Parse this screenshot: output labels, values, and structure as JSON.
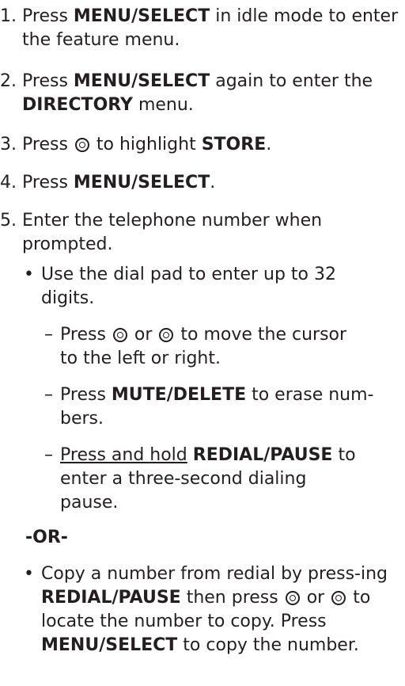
{
  "steps": [
    {
      "num": "1.",
      "a": "Press ",
      "b": "MENU/",
      "c": "SELECT",
      "d": " in idle mode to enter the feature menu."
    },
    {
      "num": "2.",
      "a": "Press ",
      "b": "MENU/",
      "c": "SELECT",
      "d": " again to enter the ",
      "e": "DIRECTORY",
      "f": " menu."
    },
    {
      "num": "3.",
      "a": "Press ",
      "b": " to highlight ",
      "c": "STORE",
      "d": "."
    },
    {
      "num": "4.",
      "a": "Press ",
      "b": "MENU/",
      "c": "SELECT",
      "d": "."
    },
    {
      "num": "5.",
      "a": "Enter the telephone number when prompted."
    }
  ],
  "bullet1": {
    "sym": "•",
    "text": "Use the dial pad to enter up to 32 digits."
  },
  "dash1": {
    "sym": "–",
    "a": "Press ",
    "b": " or ",
    "c": " to move the cursor to the left or right."
  },
  "dash2": {
    "sym": "–",
    "a": "Press ",
    "b": "MUTE/",
    "c": "DELETE",
    "d": " to erase num-bers."
  },
  "dash3": {
    "sym": "–",
    "a": "Press and hold",
    "b": " ",
    "c": "REDIAL/",
    "d": "PAUSE",
    "e": " to enter a three-second dialing pause."
  },
  "or_label": "-OR-",
  "bullet2": {
    "sym": "•",
    "a": "Copy a number from redial by press-ing ",
    "b": "REDIAL/",
    "c": "PAUSE",
    "d": " then press ",
    "e": " or ",
    "f": " to locate the number to copy. Press ",
    "g": "MENU/",
    "h": "SELECT",
    "i": " to copy the number."
  },
  "icons": {
    "scroll": "scroll-navigation-icon"
  }
}
